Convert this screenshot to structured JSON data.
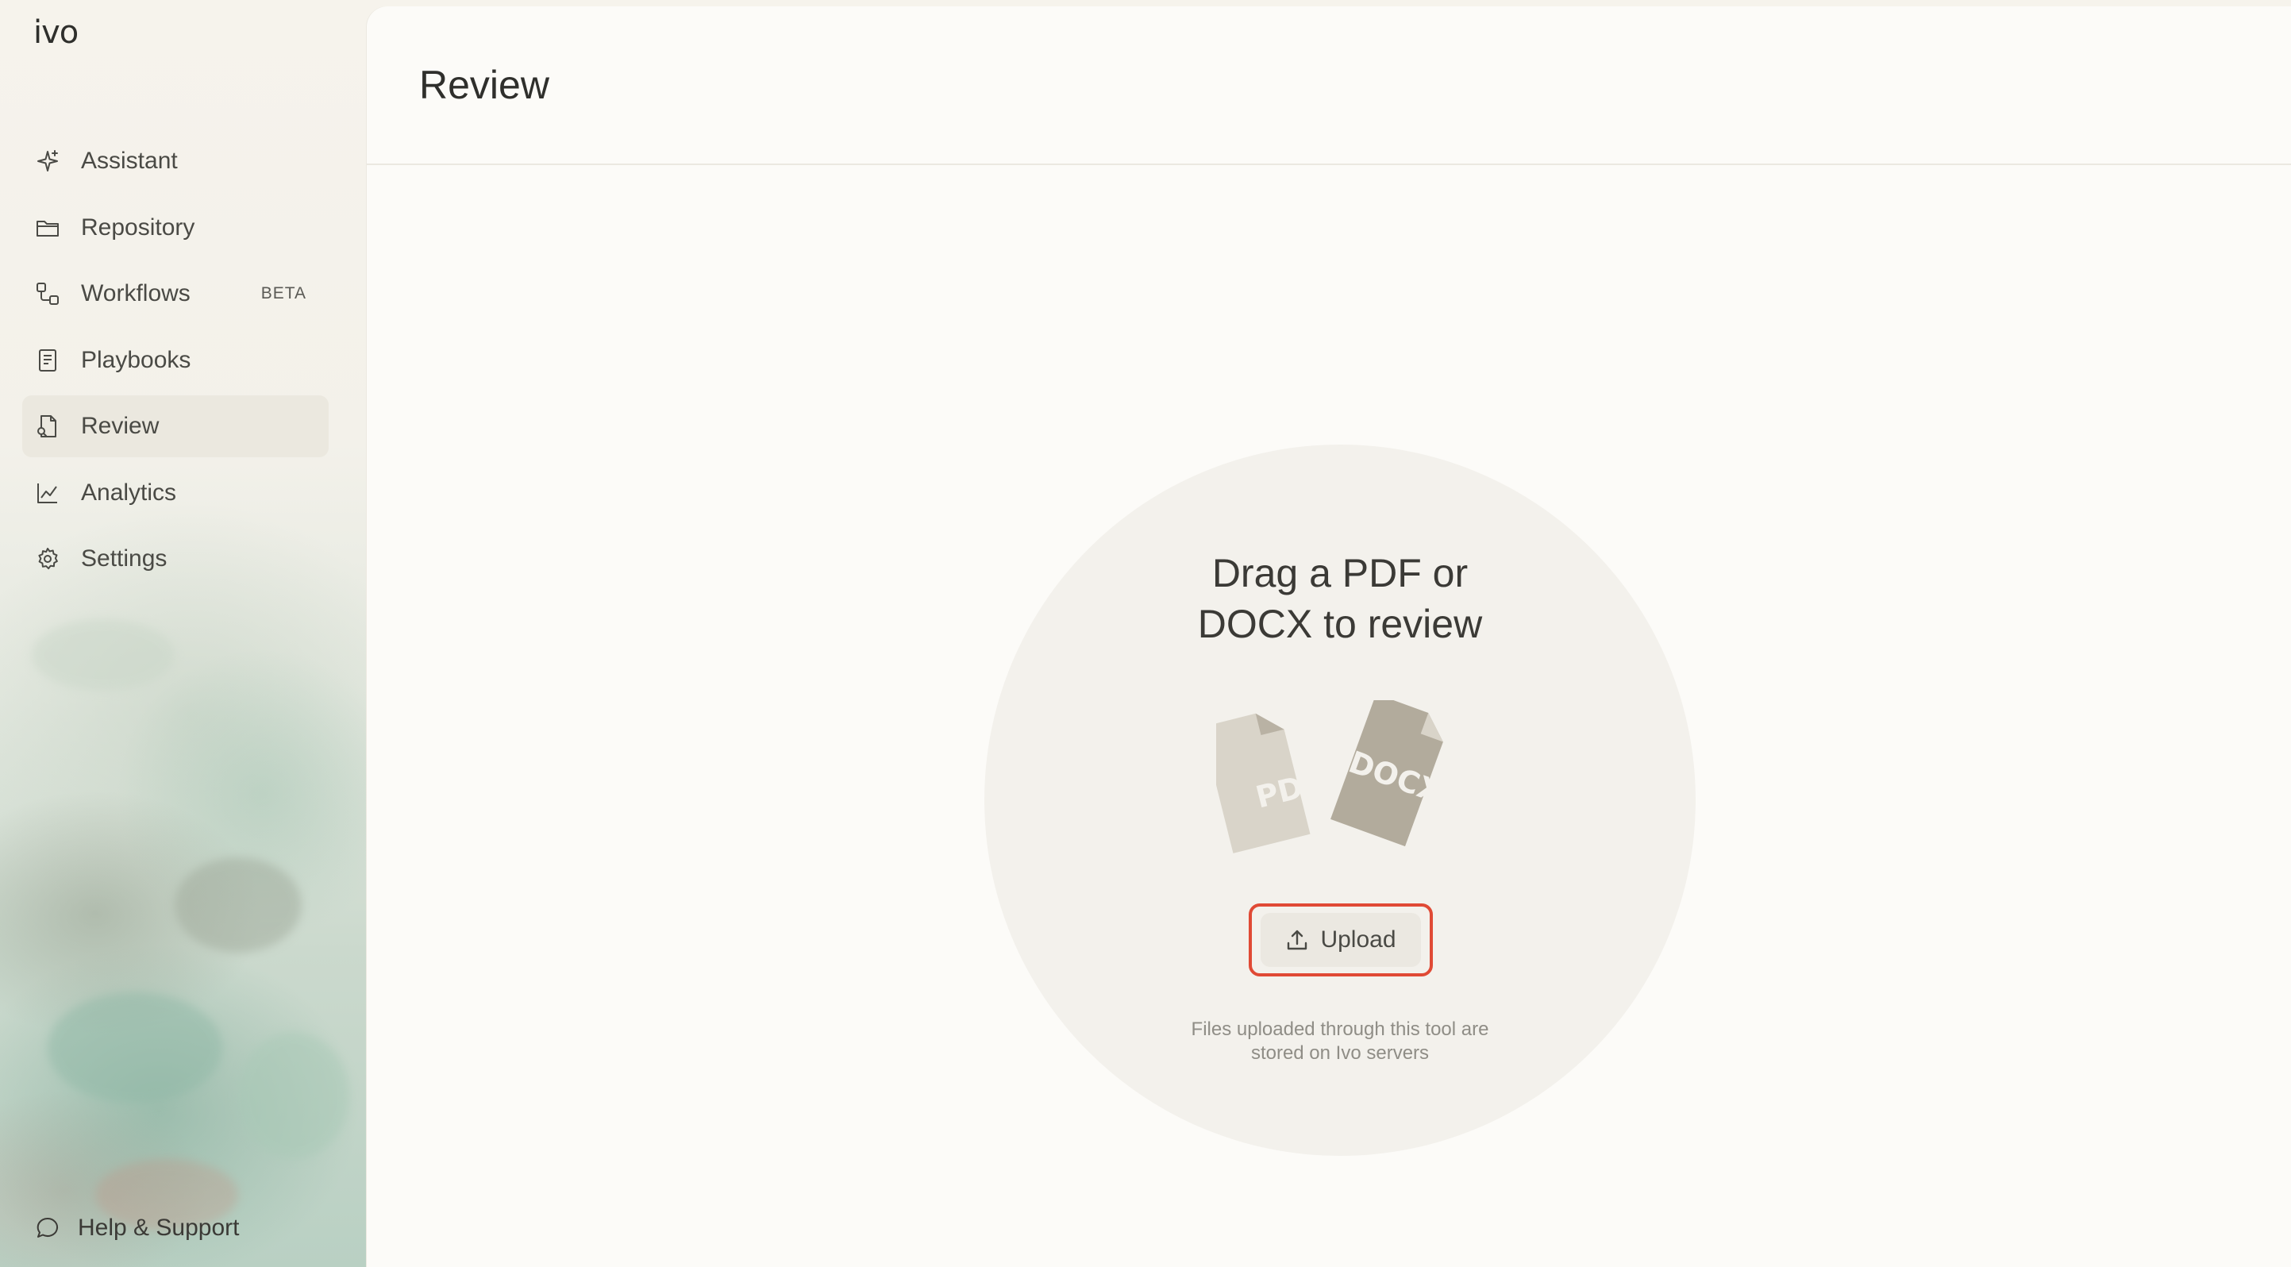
{
  "app": {
    "logo_text": "ivo"
  },
  "sidebar": {
    "items": [
      {
        "label": "Assistant",
        "icon": "sparkle-icon",
        "badge": ""
      },
      {
        "label": "Repository",
        "icon": "folder-icon",
        "badge": ""
      },
      {
        "label": "Workflows",
        "icon": "workflow-icon",
        "badge": "BETA"
      },
      {
        "label": "Playbooks",
        "icon": "document-list-icon",
        "badge": ""
      },
      {
        "label": "Review",
        "icon": "document-search-icon",
        "badge": "",
        "active": true
      },
      {
        "label": "Analytics",
        "icon": "line-chart-icon",
        "badge": ""
      },
      {
        "label": "Settings",
        "icon": "gear-icon",
        "badge": ""
      }
    ],
    "help_label": "Help & Support",
    "help_icon": "chat-bubble-icon"
  },
  "main": {
    "page_title": "Review",
    "dropzone": {
      "title_line1": "Drag a PDF or",
      "title_line2": "DOCX to review",
      "file_labels": [
        "PDF",
        "DOCX"
      ],
      "upload_label": "Upload",
      "upload_icon": "upload-icon",
      "note_line1": "Files uploaded through this tool are",
      "note_line2": "stored on Ivo servers"
    }
  },
  "colors": {
    "highlight": "#e04a35",
    "active_nav_bg": "#ebe8df",
    "main_bg": "#fcfbf8",
    "dropzone_bg": "#f3f1ec"
  }
}
